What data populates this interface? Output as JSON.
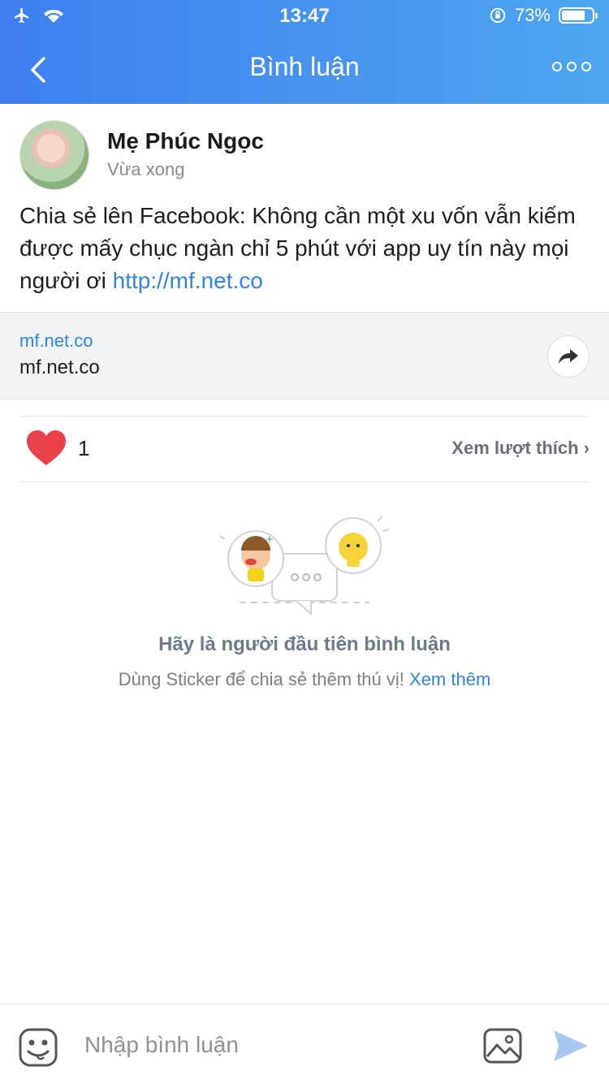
{
  "status_bar": {
    "time": "13:47",
    "battery": "73%"
  },
  "nav": {
    "title": "Bình luận"
  },
  "post": {
    "author": "Mẹ Phúc Ngọc",
    "time": "Vừa xong",
    "text": "Chia sẻ lên Facebook: Không cần một xu vốn vẫn kiếm được mấy chục ngàn chỉ 5 phút với app uy tín này mọi người ơi ",
    "link": "http://mf.net.co"
  },
  "preview": {
    "domain": "mf.net.co",
    "title": "mf.net.co"
  },
  "likes": {
    "count": "1",
    "see_likes": "Xem lượt thích"
  },
  "empty": {
    "headline": "Hãy là người đầu tiên bình luận",
    "sub": "Dùng Sticker để chia sẻ thêm thú vị! ",
    "more": "Xem thêm"
  },
  "composer": {
    "placeholder": "Nhập bình luận"
  },
  "colors": {
    "header_start": "#3f7ff0",
    "header_end": "#4ea6f0",
    "link": "#2f84e6",
    "heart": "#e8414a"
  }
}
